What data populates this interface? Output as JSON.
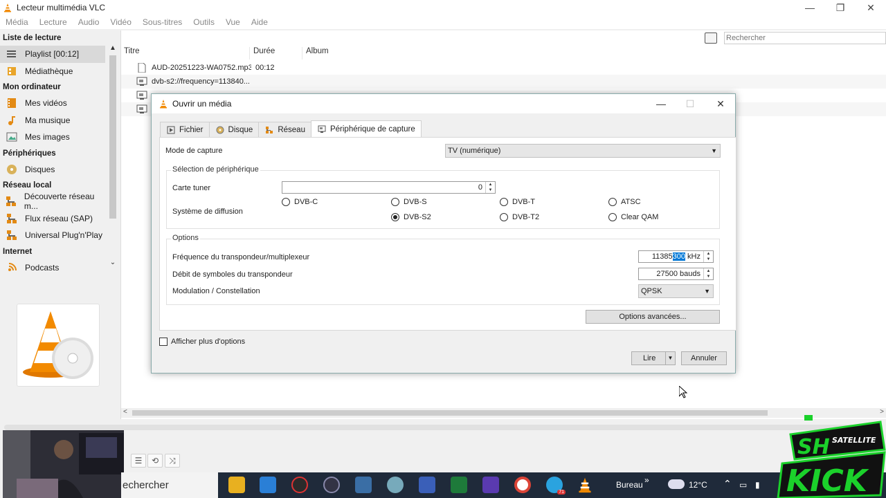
{
  "window": {
    "title": "Lecteur multimédia VLC",
    "controls": [
      "—",
      "❐",
      "✕"
    ]
  },
  "menu": [
    "Média",
    "Lecture",
    "Audio",
    "Vidéo",
    "Sous-titres",
    "Outils",
    "Vue",
    "Aide"
  ],
  "sidebar": {
    "sections": [
      {
        "heading": "Liste de lecture",
        "items": [
          {
            "label": "Playlist [00:12]",
            "icon": "playlist-icon",
            "selected": true
          },
          {
            "label": "Médiathèque",
            "icon": "library-icon"
          }
        ]
      },
      {
        "heading": "Mon ordinateur",
        "items": [
          {
            "label": "Mes vidéos",
            "icon": "videos-icon"
          },
          {
            "label": "Ma musique",
            "icon": "music-icon"
          },
          {
            "label": "Mes images",
            "icon": "images-icon"
          }
        ]
      },
      {
        "heading": "Périphériques",
        "items": [
          {
            "label": "Disques",
            "icon": "disc-icon"
          }
        ]
      },
      {
        "heading": "Réseau local",
        "items": [
          {
            "label": "Découverte réseau m...",
            "icon": "network-icon"
          },
          {
            "label": "Flux réseau (SAP)",
            "icon": "network-icon"
          },
          {
            "label": "Universal Plug'n'Play",
            "icon": "network-icon"
          }
        ]
      },
      {
        "heading": "Internet",
        "items": [
          {
            "label": "Podcasts",
            "icon": "podcast-icon"
          }
        ]
      }
    ]
  },
  "playlist": {
    "search_placeholder": "Rechercher",
    "columns": [
      "Titre",
      "Durée",
      "Album"
    ],
    "rows": [
      {
        "title": "AUD-20251223-WA0752.mp3",
        "duration": "00:12",
        "icon": "audio-file-icon"
      },
      {
        "title": "dvb-s2://frequency=113840...",
        "duration": "",
        "icon": "capture-icon"
      },
      {
        "title": "",
        "duration": "",
        "icon": "capture-icon"
      },
      {
        "title": "",
        "duration": "",
        "icon": "capture-icon"
      }
    ]
  },
  "dialog": {
    "title": "Ouvrir un média",
    "tabs": [
      {
        "label": "Fichier",
        "icon": "file-icon"
      },
      {
        "label": "Disque",
        "icon": "disc-icon"
      },
      {
        "label": "Réseau",
        "icon": "network-icon"
      },
      {
        "label": "Périphérique de capture",
        "icon": "capture-icon",
        "active": true
      }
    ],
    "capture_mode_label": "Mode de capture",
    "capture_mode_value": "TV (numérique)",
    "device_group": "Sélection de périphérique",
    "tuner_label": "Carte tuner",
    "tuner_value": "0",
    "broadcast_label": "Système de diffusion",
    "broadcast_options": [
      {
        "label": "DVB-C",
        "checked": false
      },
      {
        "label": "DVB-S",
        "checked": false
      },
      {
        "label": "DVB-T",
        "checked": false
      },
      {
        "label": "ATSC",
        "checked": false
      },
      {
        "label": "DVB-S2",
        "checked": true
      },
      {
        "label": "DVB-T2",
        "checked": false
      },
      {
        "label": "Clear QAM",
        "checked": false
      }
    ],
    "options_group": "Options",
    "frequency_label": "Fréquence du transpondeur/multiplexeur",
    "frequency_value_plain": "11385",
    "frequency_value_selected": "300",
    "frequency_unit": "kHz",
    "symbol_rate_label": "Débit de symboles du transpondeur",
    "symbol_rate_value": "27500 bauds",
    "modulation_label": "Modulation / Constellation",
    "modulation_value": "QPSK",
    "advanced_button": "Options avancées...",
    "more_options_label": "Afficher plus d'options",
    "play_button": "Lire",
    "cancel_button": "Annuler"
  },
  "taskbar": {
    "search_text": "echercher",
    "desktop_label": "Bureau",
    "weather": "12°C",
    "telegram_badge": "71"
  },
  "overlay": {
    "brand_top": "SH",
    "brand_sub": "SATELLITE",
    "brand_main": "KICK"
  },
  "colors": {
    "vlc_orange": "#f28a00",
    "selection_blue": "#0078d7",
    "taskbar_bg": "#1f2a3a",
    "logo_green": "#1bd12b"
  }
}
